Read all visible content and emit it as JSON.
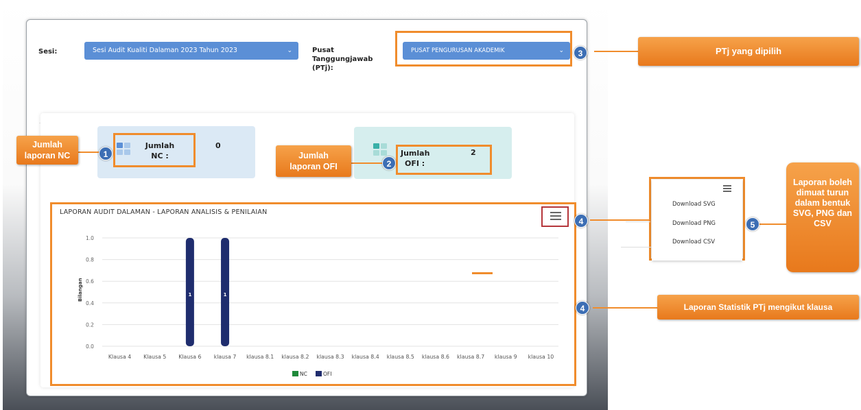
{
  "form": {
    "sesi_label": "Sesi:",
    "sesi_value": "Sesi Audit Kualiti Dalaman 2023 Tahun 2023",
    "ptj_label_1": "Pusat",
    "ptj_label_2": "Tanggungjawab",
    "ptj_label_3": "(PTj):",
    "ptj_value": "PUSAT PENGURUSAN AKADEMIK"
  },
  "stats": {
    "nc_label_1": "Jumlah",
    "nc_label_2": "NC :",
    "nc_value": "0",
    "ofi_label_1": "Jumlah",
    "ofi_label_2": "OFI :",
    "ofi_value": "2"
  },
  "export_menu": {
    "items": [
      "Download SVG",
      "Download PNG",
      "Download CSV"
    ]
  },
  "callouts": {
    "c1": "Jumlah laporan NC",
    "c2": "Jumlah laporan OFI",
    "c3": "PTj yang dipilih",
    "c4": "Laporan Statistik PTj mengikut klausa",
    "c5": "Laporan boleh dimuat turun dalam bentuk SVG, PNG dan CSV",
    "n1": "1",
    "n2": "2",
    "n3": "3",
    "n4": "4",
    "n5": "5"
  },
  "colors": {
    "nc": "#1e8a3a",
    "ofi": "#1f2d6e",
    "accent": "#f08c2c",
    "select": "#5b8fd6"
  },
  "chart_data": {
    "type": "bar",
    "title": "LAPORAN AUDIT DALAMAN - LAPORAN ANALISIS & PENILAIAN",
    "ylabel": "Bilangan",
    "xlabel": "",
    "ylim": [
      0,
      1
    ],
    "yticks": [
      "0.0",
      "0.2",
      "0.4",
      "0.6",
      "0.8",
      "1.0"
    ],
    "categories": [
      "Klausa 4",
      "Klausa 5",
      "Klausa 6",
      "klausa 7",
      "klausa 8.1",
      "klausa 8.2",
      "klausa 8.3",
      "klausa 8.4",
      "klausa 8.5",
      "klausa 8.6",
      "klausa 8.7",
      "klausa 9",
      "klausa 10"
    ],
    "series": [
      {
        "name": "NC",
        "values": [
          0,
          0,
          0,
          0,
          0,
          0,
          0,
          0,
          0,
          0,
          0,
          0,
          0
        ]
      },
      {
        "name": "OFI",
        "values": [
          0,
          0,
          1,
          1,
          0,
          0,
          0,
          0,
          0,
          0,
          0,
          0,
          0
        ]
      }
    ],
    "legend": "bottom-center",
    "grid": true
  }
}
